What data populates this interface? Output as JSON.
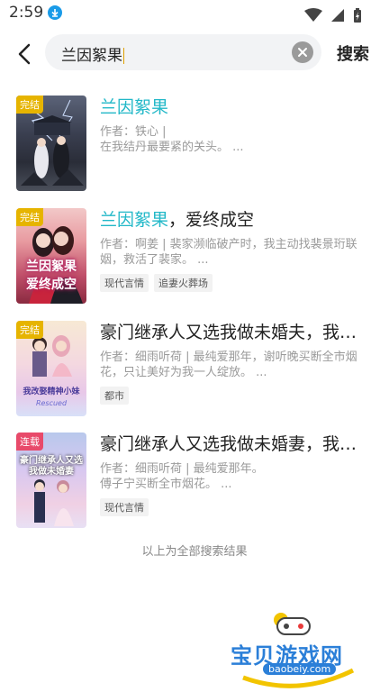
{
  "status_bar": {
    "time": "2:59"
  },
  "search": {
    "query": "兰因絮果",
    "button_label": "搜索"
  },
  "results": [
    {
      "status": "完结",
      "status_color": "#e6b400",
      "title_highlight": "兰因絮果",
      "title_rest": "",
      "meta_line1": "作者：铁心 |",
      "meta_line2": "在我结丹最要紧的关头。 ...",
      "tags": []
    },
    {
      "status": "完结",
      "status_color": "#e6b400",
      "title_highlight": "兰因絮果",
      "title_rest": "，爱终成空",
      "cover_title": "兰因絮果 爱终成空",
      "meta_line1": "作者：啊姜 | 裴家濒临破产时，我主动找裴景珩联",
      "meta_line2": "姻，救活了裴家。 ...",
      "tags": [
        "现代言情",
        "追妻火葬场"
      ]
    },
    {
      "status": "完结",
      "status_color": "#e6b400",
      "title_highlight": "",
      "title_rest": "豪门继承人又选我做未婚夫，我改...",
      "cover_title": "我改娶精神小妹",
      "cover_subtitle": "Rescued",
      "meta_line1": "作者：细雨听荷 | 最纯爱那年，谢听晚买断全市烟",
      "meta_line2": "花，只让美好为我一人绽放。 ...",
      "tags": [
        "都市"
      ]
    },
    {
      "status": "连载",
      "status_color": "#e84a6a",
      "title_highlight": "",
      "title_rest": "豪门继承人又选我做未婚妻，我改...",
      "cover_title": "豪门继承人又选我做未婚妻",
      "meta_line1": "作者：细雨听荷 | 最纯爱那年。",
      "meta_line2": "傅子宁买断全市烟花。 ...",
      "tags": [
        "现代言情"
      ]
    }
  ],
  "end_text": "以上为全部搜索结果",
  "watermark": {
    "text": "宝贝游戏网",
    "url": "baobeiy.com"
  }
}
